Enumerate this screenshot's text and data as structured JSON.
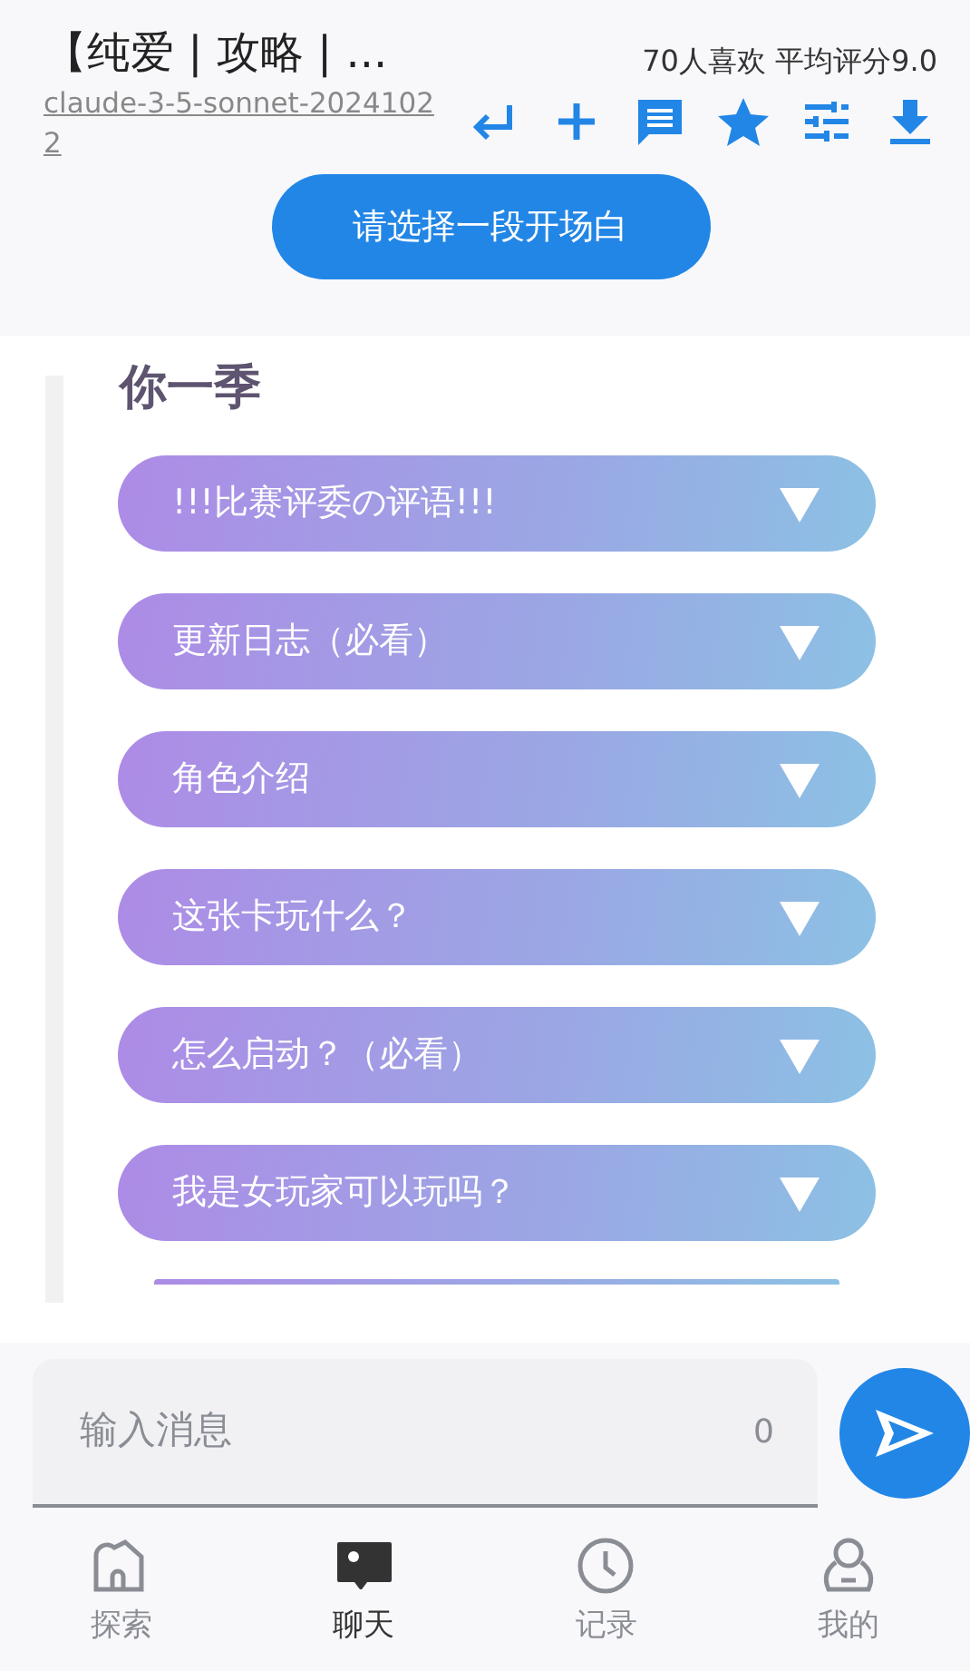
{
  "header": {
    "title": "【纯爱 | 攻略 | ...",
    "model": "claude-3-5-sonnet-20241022",
    "stats": "70人喜欢 平均评分9.0"
  },
  "toolbar": [
    {
      "kind": "return"
    },
    {
      "kind": "add"
    },
    {
      "kind": "comment"
    },
    {
      "kind": "star"
    },
    {
      "kind": "settings"
    },
    {
      "kind": "download"
    }
  ],
  "opening_button": "请选择一段开场白",
  "content": {
    "heading": "你一季",
    "sections": [
      {
        "label": "!!!比赛评委の评语!!!",
        "expanded": false
      },
      {
        "label": "更新日志（必看）",
        "expanded": false
      },
      {
        "label": "角色介绍",
        "expanded": false
      },
      {
        "label": "这张卡玩什么？",
        "expanded": false
      },
      {
        "label": "怎么启动？（必看）",
        "expanded": false
      },
      {
        "label": "我是女玩家可以玩吗？",
        "expanded": false
      }
    ]
  },
  "composer": {
    "placeholder": "输入消息",
    "count": "0"
  },
  "nav": [
    {
      "label": "探索",
      "kind": "explore",
      "selected": false
    },
    {
      "label": "聊天",
      "kind": "chat",
      "selected": true
    },
    {
      "label": "记录",
      "kind": "history",
      "selected": false
    },
    {
      "label": "我的",
      "kind": "profile",
      "selected": false
    }
  ]
}
